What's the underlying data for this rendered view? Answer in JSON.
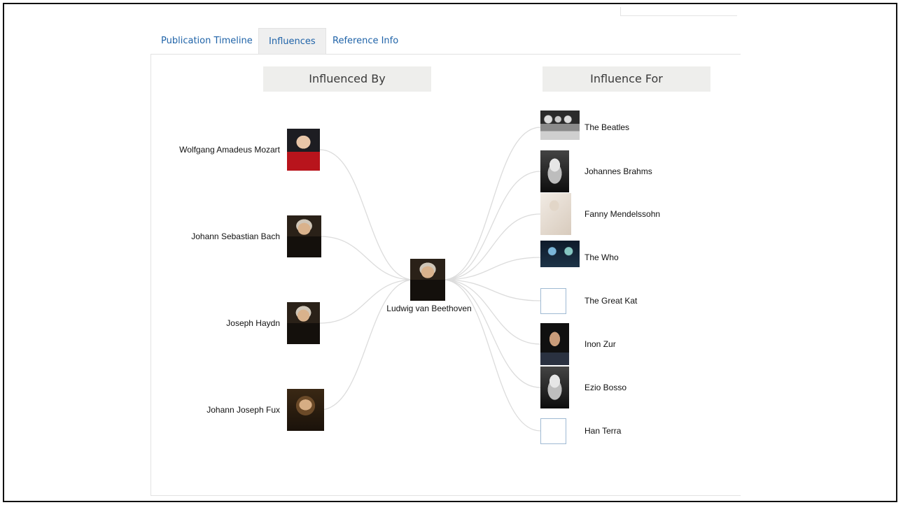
{
  "tabs": [
    {
      "label": "Publication Timeline",
      "active": false
    },
    {
      "label": "Influences",
      "active": true
    },
    {
      "label": "Reference Info",
      "active": false
    }
  ],
  "influenced_by": {
    "heading": "Influenced By",
    "items": [
      {
        "name": "Wolfgang Amadeus Mozart",
        "image": "portrait-red",
        "has_image": true
      },
      {
        "name": "Johann Sebastian Bach",
        "image": "portrait-dark",
        "has_image": true
      },
      {
        "name": "Joseph Haydn",
        "image": "portrait-dark",
        "has_image": true
      },
      {
        "name": "Johann Joseph Fux",
        "image": "portrait-brown",
        "has_image": true
      }
    ]
  },
  "center": {
    "name": "Ludwig van Beethoven",
    "image": "portrait-dark"
  },
  "influence_for": {
    "heading": "Influence For",
    "items": [
      {
        "name": "The Beatles",
        "image": "photo-bw-group",
        "has_image": true
      },
      {
        "name": "Johannes Brahms",
        "image": "photo-bw-portrait",
        "has_image": true
      },
      {
        "name": "Fanny Mendelssohn",
        "image": "sketch-portrait",
        "has_image": true
      },
      {
        "name": "The Who",
        "image": "photo-stage",
        "has_image": true
      },
      {
        "name": "The Great Kat",
        "image": "placeholder",
        "has_image": false
      },
      {
        "name": "Inon Zur",
        "image": "photo-portrait",
        "has_image": true
      },
      {
        "name": "Ezio Bosso",
        "image": "photo-bw-portrait",
        "has_image": true
      },
      {
        "name": "Han Terra",
        "image": "placeholder",
        "has_image": false
      }
    ]
  },
  "colors": {
    "link": "#1f63a8",
    "edge": "#dcdcdc",
    "header_bg": "#eeeeec",
    "placeholder_border": "#9fbad3"
  }
}
